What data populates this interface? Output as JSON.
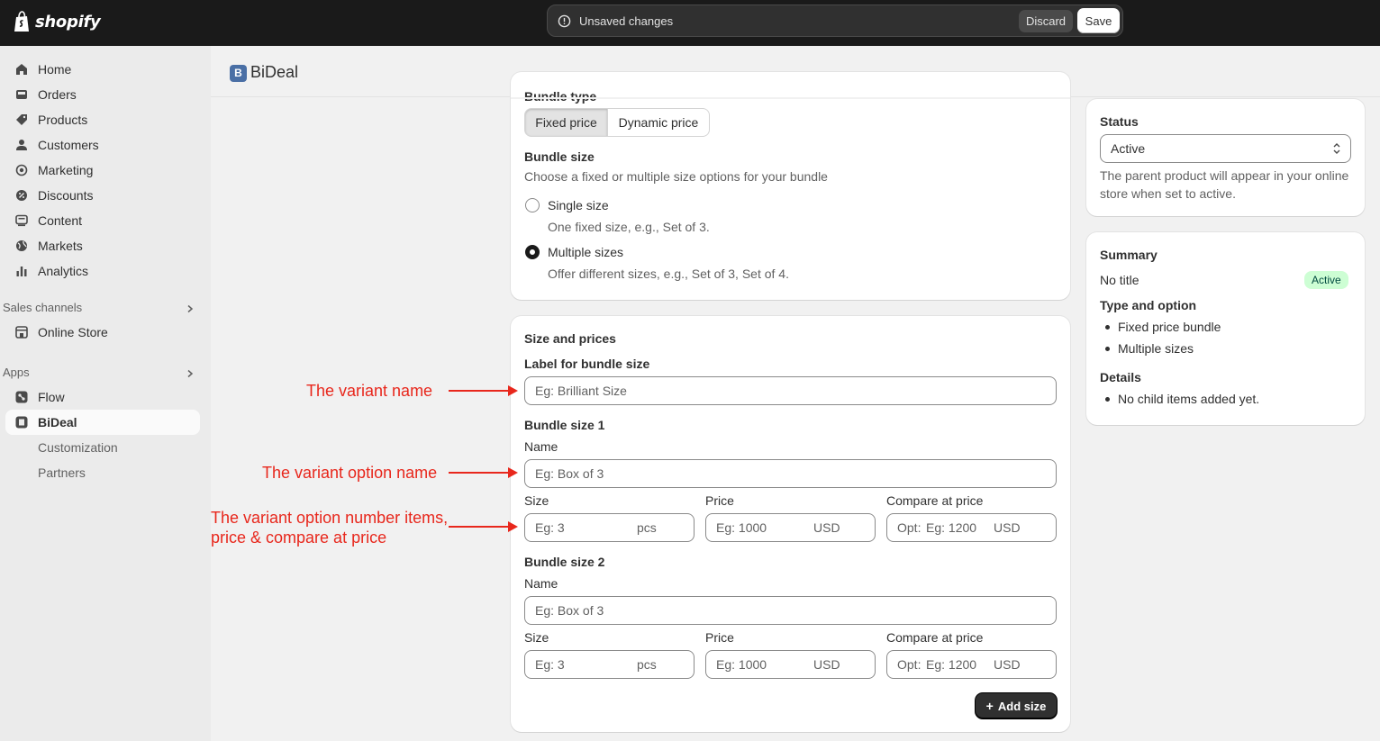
{
  "topbar": {
    "brand": "shopify",
    "unsaved_text": "Unsaved changes",
    "discard_label": "Discard",
    "save_label": "Save"
  },
  "sidebar": {
    "items": [
      {
        "label": "Home",
        "icon": "home-icon"
      },
      {
        "label": "Orders",
        "icon": "inbox-icon"
      },
      {
        "label": "Products",
        "icon": "tag-icon"
      },
      {
        "label": "Customers",
        "icon": "person-icon"
      },
      {
        "label": "Marketing",
        "icon": "target-icon"
      },
      {
        "label": "Discounts",
        "icon": "discount-icon"
      },
      {
        "label": "Content",
        "icon": "content-icon"
      },
      {
        "label": "Markets",
        "icon": "globe-icon"
      },
      {
        "label": "Analytics",
        "icon": "bar-chart-icon"
      }
    ],
    "sales_channels_label": "Sales channels",
    "online_store_label": "Online Store",
    "apps_label": "Apps",
    "apps": [
      {
        "label": "Flow"
      },
      {
        "label": "BiDeal"
      },
      {
        "label": "Customization"
      },
      {
        "label": "Partners"
      }
    ]
  },
  "header": {
    "app_logo": "B",
    "title": "BiDeal"
  },
  "bundle_card": {
    "bundle_type_label": "Bundle type",
    "fixed_price": "Fixed price",
    "dynamic_price": "Dynamic price",
    "bundle_size_title": "Bundle size",
    "bundle_size_desc": "Choose a fixed or multiple size options for your bundle",
    "single_label": "Single size",
    "single_desc": "One fixed size, e.g., Set of 3.",
    "multiple_label": "Multiple sizes",
    "multiple_desc": "Offer different sizes, e.g., Set of 3, Set of 4."
  },
  "sizes_card": {
    "title": "Size and prices",
    "label_field_label": "Label for bundle size",
    "label_placeholder": "Eg: Brilliant Size",
    "sizes": [
      {
        "title": "Bundle size 1",
        "name_label": "Name",
        "name_placeholder": "Eg: Box of 3",
        "size_label": "Size",
        "size_placeholder": "Eg: 3",
        "size_suffix": "pcs",
        "price_label": "Price",
        "price_placeholder": "Eg: 1000",
        "price_suffix": "USD",
        "compare_label": "Compare at price",
        "compare_prefix": "Opt:",
        "compare_placeholder": "Eg: 1200",
        "compare_suffix": "USD"
      },
      {
        "title": "Bundle size 2",
        "name_label": "Name",
        "name_placeholder": "Eg: Box of 3",
        "size_label": "Size",
        "size_placeholder": "Eg: 3",
        "size_suffix": "pcs",
        "price_label": "Price",
        "price_placeholder": "Eg: 1000",
        "price_suffix": "USD",
        "compare_label": "Compare at price",
        "compare_prefix": "Opt:",
        "compare_placeholder": "Eg: 1200",
        "compare_suffix": "USD"
      }
    ],
    "add_size_label": "Add size"
  },
  "status_card": {
    "title": "Status",
    "value": "Active",
    "help_line1": "The parent product will appear in your online",
    "help_line2": "store when set to active."
  },
  "summary_card": {
    "title": "Summary",
    "product_title": "No title",
    "badge": "Active",
    "type_title": "Type and option",
    "type_items": [
      "Fixed price bundle",
      "Multiple sizes"
    ],
    "details_title": "Details",
    "details_items": [
      "No child items added yet."
    ]
  },
  "annotations": {
    "variant_name": "The variant name",
    "variant_option_name": "The variant option name",
    "variant_items_line1": "The variant option number items,",
    "variant_items_line2": "price & compare at price",
    "color": "#e8271c"
  }
}
